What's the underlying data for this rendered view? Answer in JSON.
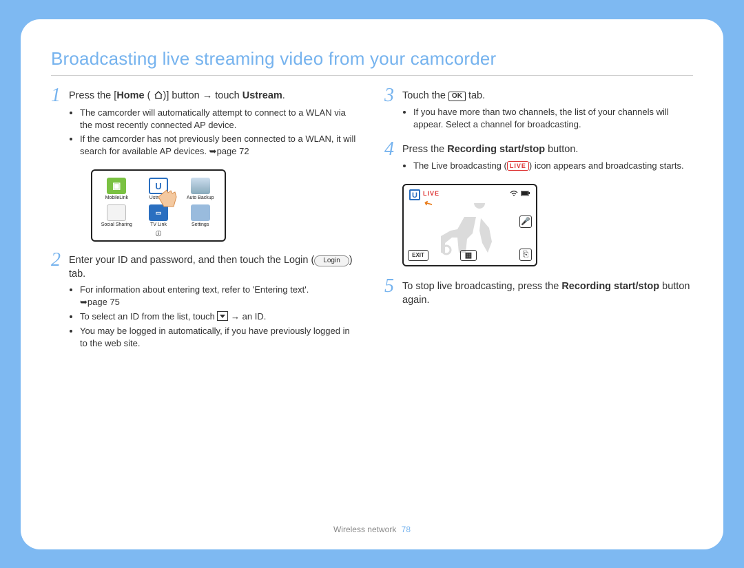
{
  "title": "Broadcasting live streaming video from your camcorder",
  "footer": {
    "section": "Wireless network",
    "page": "78"
  },
  "steps": {
    "s1": {
      "num": "1",
      "prefix": "Press the [",
      "bold1": "Home",
      "mid": " (",
      "mid2": ")] button → touch ",
      "bold2": "Ustream",
      "suffix": ".",
      "b1": "The camcorder will automatically attempt to connect to a WLAN via the most recently connected AP device.",
      "b2_a": "If the camcorder has not previously been connected to a WLAN, it will search for available AP devices. ",
      "b2_b": "page 72"
    },
    "s2": {
      "num": "2",
      "lead_a": "Enter your ID and password, and then touch the Login (",
      "lead_b": ") tab.",
      "b1_a": "For information about entering text, refer to 'Entering text'. ",
      "b1_b": "page 75",
      "b2_a": "To select an ID from the list, touch ",
      "b2_b": " → an ID.",
      "b3": "You may be logged in automatically, if you have previously logged in to the web site."
    },
    "s3": {
      "num": "3",
      "lead_a": "Touch the ",
      "ok": "OK",
      "lead_b": " tab.",
      "b1": "If you have more than two channels, the list of your channels will appear. Select a channel for broadcasting."
    },
    "s4": {
      "num": "4",
      "lead_a": "Press the ",
      "bold": "Recording start/stop",
      "lead_b": " button.",
      "b1_a": "The Live broadcasting (",
      "live": "LIVE",
      "b1_b": ") icon appears and broadcasting starts."
    },
    "s5": {
      "num": "5",
      "lead_a": "To stop live broadcasting, press the ",
      "bold": "Recording start/stop",
      "lead_b": " button again."
    }
  },
  "menu": {
    "items": [
      {
        "label": "MobileLink"
      },
      {
        "label": "Ustream"
      },
      {
        "label": "Auto Backup"
      },
      {
        "label": "Social Sharing"
      },
      {
        "label": "TV Link"
      },
      {
        "label": "Settings"
      }
    ]
  },
  "login_label": "Login",
  "live_screen": {
    "u": "U",
    "live": "LIVE",
    "exit": "EXIT"
  }
}
